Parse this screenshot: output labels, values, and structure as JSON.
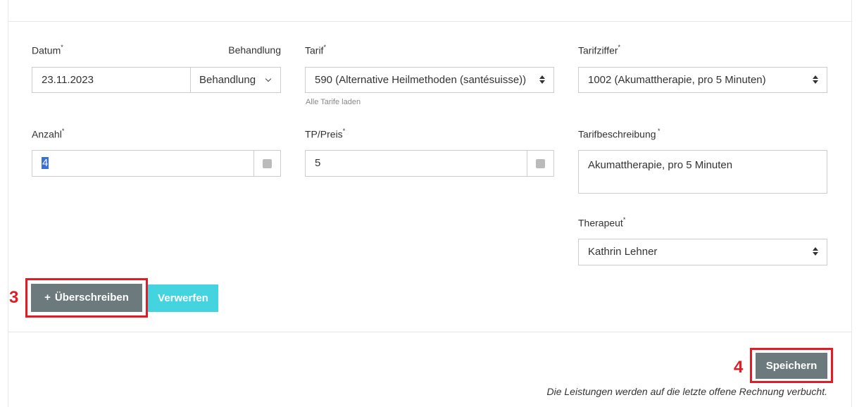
{
  "form": {
    "datum": {
      "label": "Datum",
      "required": "*",
      "value": "23.11.2023"
    },
    "behandlung": {
      "label": "Behandlung",
      "button": "Behandlung"
    },
    "tarif": {
      "label": "Tarif",
      "required": "*",
      "value": "590 (Alternative Heilmethoden (santésuisse))",
      "hint": "Alle Tarife laden"
    },
    "tarifziffer": {
      "label": "Tarifziffer",
      "required": "*",
      "value": "1002 (Akumattherapie, pro 5 Minuten)"
    },
    "anzahl": {
      "label": "Anzahl",
      "required": "*",
      "value": "4"
    },
    "tp_preis": {
      "label": "TP/Preis",
      "required": "*",
      "value": "5"
    },
    "tarifbeschreibung": {
      "label": "Tarifbeschreibung",
      "required": " *",
      "value": "Akumattherapie, pro 5 Minuten"
    },
    "therapeut": {
      "label": "Therapeut",
      "required": "*",
      "value": "Kathrin Lehner"
    }
  },
  "actions": {
    "overwrite": {
      "icon": "plus-icon",
      "glyph": "+",
      "label": "Überschreiben"
    },
    "discard": {
      "label": "Verwerfen"
    },
    "save": {
      "label": "Speichern"
    }
  },
  "footer": {
    "note": "Die Leistungen werden auf die letzte offene Rechnung verbucht."
  },
  "annotations": {
    "step3": "3",
    "step4": "4"
  },
  "colors": {
    "primary_button": "#6c7a7d",
    "secondary_button": "#44d4e0",
    "annotation": "#e21b24",
    "selection": "#3a6fd8"
  }
}
